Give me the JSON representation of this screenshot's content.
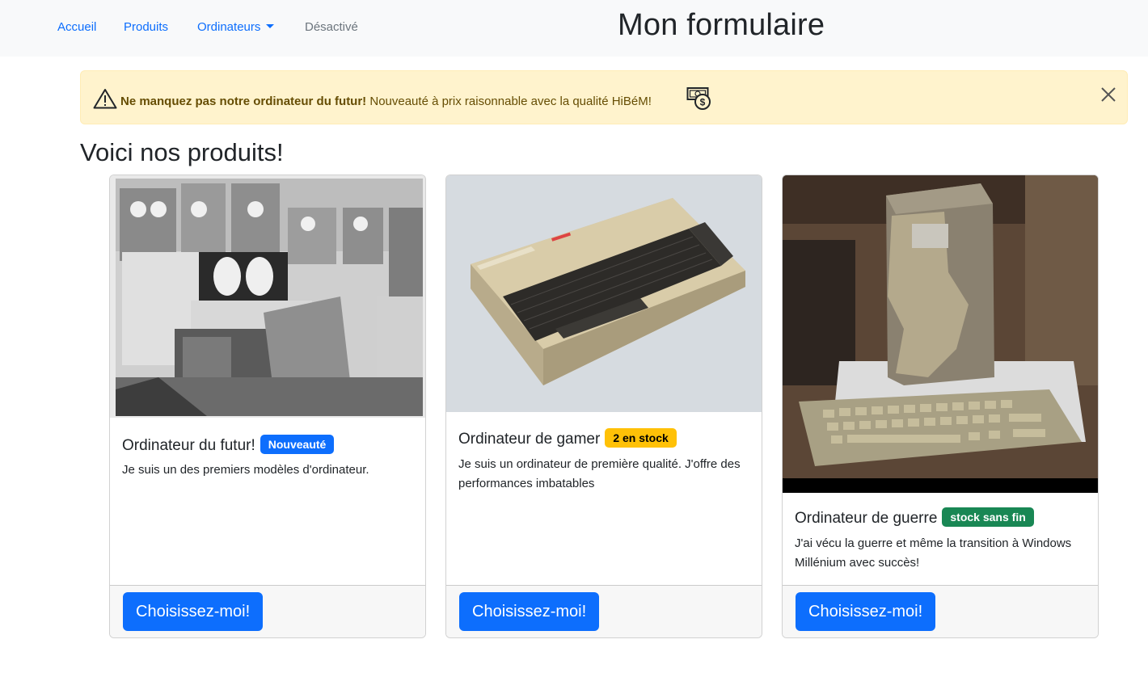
{
  "navbar": {
    "links": [
      {
        "label": "Accueil"
      },
      {
        "label": "Produits"
      },
      {
        "label": "Ordinateurs"
      },
      {
        "label": "Désactivé"
      }
    ],
    "title": "Mon formulaire"
  },
  "alert": {
    "bold_text": "Ne manquez pas notre ordinateur du futur!",
    "text": " Nouveauté à prix raisonnable avec la qualité HiBéM!",
    "icons": [
      "warning-triangle-icon",
      "money-icon",
      "close-icon"
    ]
  },
  "section_title": "Voici nos produits!",
  "products": [
    {
      "title": "Ordinateur du futur!",
      "badge": "Nouveauté",
      "badge_color": "#0d6efd",
      "description": "Je suis un des premiers modèles d'ordinateur.",
      "button": "Choisissez-moi!"
    },
    {
      "title": "Ordinateur de gamer",
      "badge": "2 en stock",
      "badge_color": "#ffc107",
      "description": "Je suis un ordinateur de première qualité. J'offre des performances imbatables",
      "button": "Choisissez-moi!"
    },
    {
      "title": "Ordinateur de guerre",
      "badge": "stock sans fin",
      "badge_color": "#198754",
      "description": "J'ai vécu la guerre et même la transition à Windows Millénium avec succès!",
      "button": "Choisissez-moi!"
    }
  ]
}
